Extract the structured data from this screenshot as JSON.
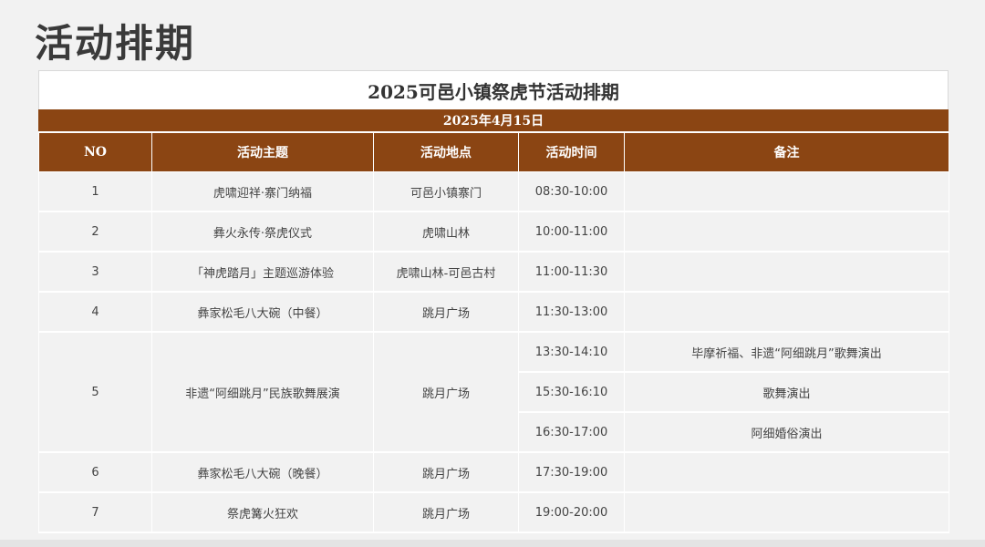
{
  "page_title": "活动排期",
  "table_title": "2025可邑小镇祭虎节活动排期",
  "date": "2025年4月15日",
  "headers": {
    "no": "NO",
    "theme": "活动主题",
    "location": "活动地点",
    "time": "活动时间",
    "remark": "备注"
  },
  "rows": [
    {
      "no": "1",
      "theme": "虎啸迎祥·寨门纳福",
      "location": "可邑小镇寨门",
      "time": "08:30-10:00",
      "remark": ""
    },
    {
      "no": "2",
      "theme": "彝火永传·祭虎仪式",
      "location": "虎啸山林",
      "time": "10:00-11:00",
      "remark": ""
    },
    {
      "no": "3",
      "theme": "「神虎踏月」主题巡游体验",
      "location": "虎啸山林-可邑古村",
      "time": "11:00-11:30",
      "remark": ""
    },
    {
      "no": "4",
      "theme": "彝家松毛八大碗（中餐）",
      "location": "跳月广场",
      "time": "11:30-13:00",
      "remark": ""
    },
    {
      "no": "5",
      "theme": "非遗“阿细跳月”民族歌舞展演",
      "location": "跳月广场",
      "slots": [
        {
          "time": "13:30-14:10",
          "remark": "毕摩祈福、非遗“阿细跳月”歌舞演出"
        },
        {
          "time": "15:30-16:10",
          "remark": "歌舞演出"
        },
        {
          "time": "16:30-17:00",
          "remark": "阿细婚俗演出"
        }
      ]
    },
    {
      "no": "6",
      "theme": "彝家松毛八大碗（晚餐）",
      "location": "跳月广场",
      "time": "17:30-19:00",
      "remark": ""
    },
    {
      "no": "7",
      "theme": "祭虎篝火狂欢",
      "location": "跳月广场",
      "time": "19:00-20:00",
      "remark": ""
    }
  ],
  "colors": {
    "header_bg": "#8b4513",
    "cell_bg": "#f2f2f2",
    "grid_line": "#ffffff"
  }
}
